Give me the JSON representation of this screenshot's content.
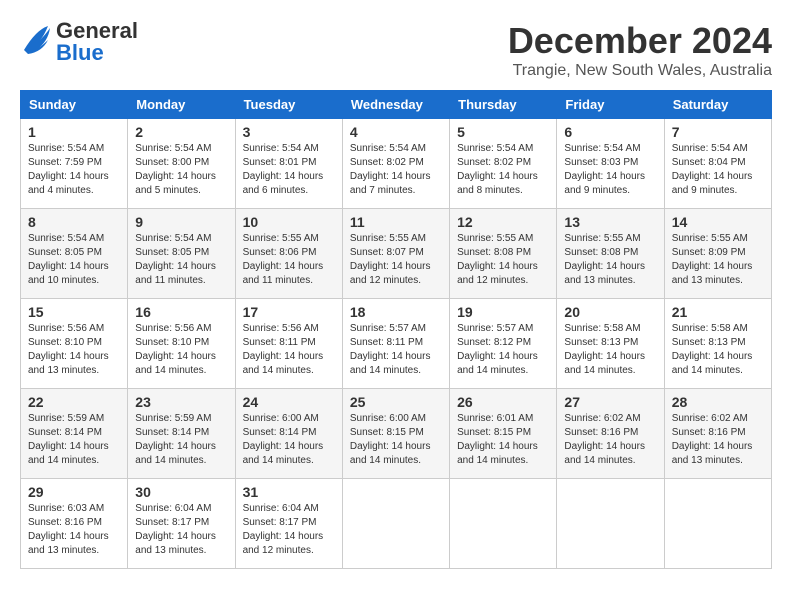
{
  "header": {
    "logo_general": "General",
    "logo_blue": "Blue",
    "month_title": "December 2024",
    "location": "Trangie, New South Wales, Australia"
  },
  "weekdays": [
    "Sunday",
    "Monday",
    "Tuesday",
    "Wednesday",
    "Thursday",
    "Friday",
    "Saturday"
  ],
  "weeks": [
    [
      {
        "day": "1",
        "sunrise": "5:54 AM",
        "sunset": "7:59 PM",
        "daylight": "14 hours and 4 minutes."
      },
      {
        "day": "2",
        "sunrise": "5:54 AM",
        "sunset": "8:00 PM",
        "daylight": "14 hours and 5 minutes."
      },
      {
        "day": "3",
        "sunrise": "5:54 AM",
        "sunset": "8:01 PM",
        "daylight": "14 hours and 6 minutes."
      },
      {
        "day": "4",
        "sunrise": "5:54 AM",
        "sunset": "8:02 PM",
        "daylight": "14 hours and 7 minutes."
      },
      {
        "day": "5",
        "sunrise": "5:54 AM",
        "sunset": "8:02 PM",
        "daylight": "14 hours and 8 minutes."
      },
      {
        "day": "6",
        "sunrise": "5:54 AM",
        "sunset": "8:03 PM",
        "daylight": "14 hours and 9 minutes."
      },
      {
        "day": "7",
        "sunrise": "5:54 AM",
        "sunset": "8:04 PM",
        "daylight": "14 hours and 9 minutes."
      }
    ],
    [
      {
        "day": "8",
        "sunrise": "5:54 AM",
        "sunset": "8:05 PM",
        "daylight": "14 hours and 10 minutes."
      },
      {
        "day": "9",
        "sunrise": "5:54 AM",
        "sunset": "8:05 PM",
        "daylight": "14 hours and 11 minutes."
      },
      {
        "day": "10",
        "sunrise": "5:55 AM",
        "sunset": "8:06 PM",
        "daylight": "14 hours and 11 minutes."
      },
      {
        "day": "11",
        "sunrise": "5:55 AM",
        "sunset": "8:07 PM",
        "daylight": "14 hours and 12 minutes."
      },
      {
        "day": "12",
        "sunrise": "5:55 AM",
        "sunset": "8:08 PM",
        "daylight": "14 hours and 12 minutes."
      },
      {
        "day": "13",
        "sunrise": "5:55 AM",
        "sunset": "8:08 PM",
        "daylight": "14 hours and 13 minutes."
      },
      {
        "day": "14",
        "sunrise": "5:55 AM",
        "sunset": "8:09 PM",
        "daylight": "14 hours and 13 minutes."
      }
    ],
    [
      {
        "day": "15",
        "sunrise": "5:56 AM",
        "sunset": "8:10 PM",
        "daylight": "14 hours and 13 minutes."
      },
      {
        "day": "16",
        "sunrise": "5:56 AM",
        "sunset": "8:10 PM",
        "daylight": "14 hours and 14 minutes."
      },
      {
        "day": "17",
        "sunrise": "5:56 AM",
        "sunset": "8:11 PM",
        "daylight": "14 hours and 14 minutes."
      },
      {
        "day": "18",
        "sunrise": "5:57 AM",
        "sunset": "8:11 PM",
        "daylight": "14 hours and 14 minutes."
      },
      {
        "day": "19",
        "sunrise": "5:57 AM",
        "sunset": "8:12 PM",
        "daylight": "14 hours and 14 minutes."
      },
      {
        "day": "20",
        "sunrise": "5:58 AM",
        "sunset": "8:13 PM",
        "daylight": "14 hours and 14 minutes."
      },
      {
        "day": "21",
        "sunrise": "5:58 AM",
        "sunset": "8:13 PM",
        "daylight": "14 hours and 14 minutes."
      }
    ],
    [
      {
        "day": "22",
        "sunrise": "5:59 AM",
        "sunset": "8:14 PM",
        "daylight": "14 hours and 14 minutes."
      },
      {
        "day": "23",
        "sunrise": "5:59 AM",
        "sunset": "8:14 PM",
        "daylight": "14 hours and 14 minutes."
      },
      {
        "day": "24",
        "sunrise": "6:00 AM",
        "sunset": "8:14 PM",
        "daylight": "14 hours and 14 minutes."
      },
      {
        "day": "25",
        "sunrise": "6:00 AM",
        "sunset": "8:15 PM",
        "daylight": "14 hours and 14 minutes."
      },
      {
        "day": "26",
        "sunrise": "6:01 AM",
        "sunset": "8:15 PM",
        "daylight": "14 hours and 14 minutes."
      },
      {
        "day": "27",
        "sunrise": "6:02 AM",
        "sunset": "8:16 PM",
        "daylight": "14 hours and 14 minutes."
      },
      {
        "day": "28",
        "sunrise": "6:02 AM",
        "sunset": "8:16 PM",
        "daylight": "14 hours and 13 minutes."
      }
    ],
    [
      {
        "day": "29",
        "sunrise": "6:03 AM",
        "sunset": "8:16 PM",
        "daylight": "14 hours and 13 minutes."
      },
      {
        "day": "30",
        "sunrise": "6:04 AM",
        "sunset": "8:17 PM",
        "daylight": "14 hours and 13 minutes."
      },
      {
        "day": "31",
        "sunrise": "6:04 AM",
        "sunset": "8:17 PM",
        "daylight": "14 hours and 12 minutes."
      },
      null,
      null,
      null,
      null
    ]
  ]
}
